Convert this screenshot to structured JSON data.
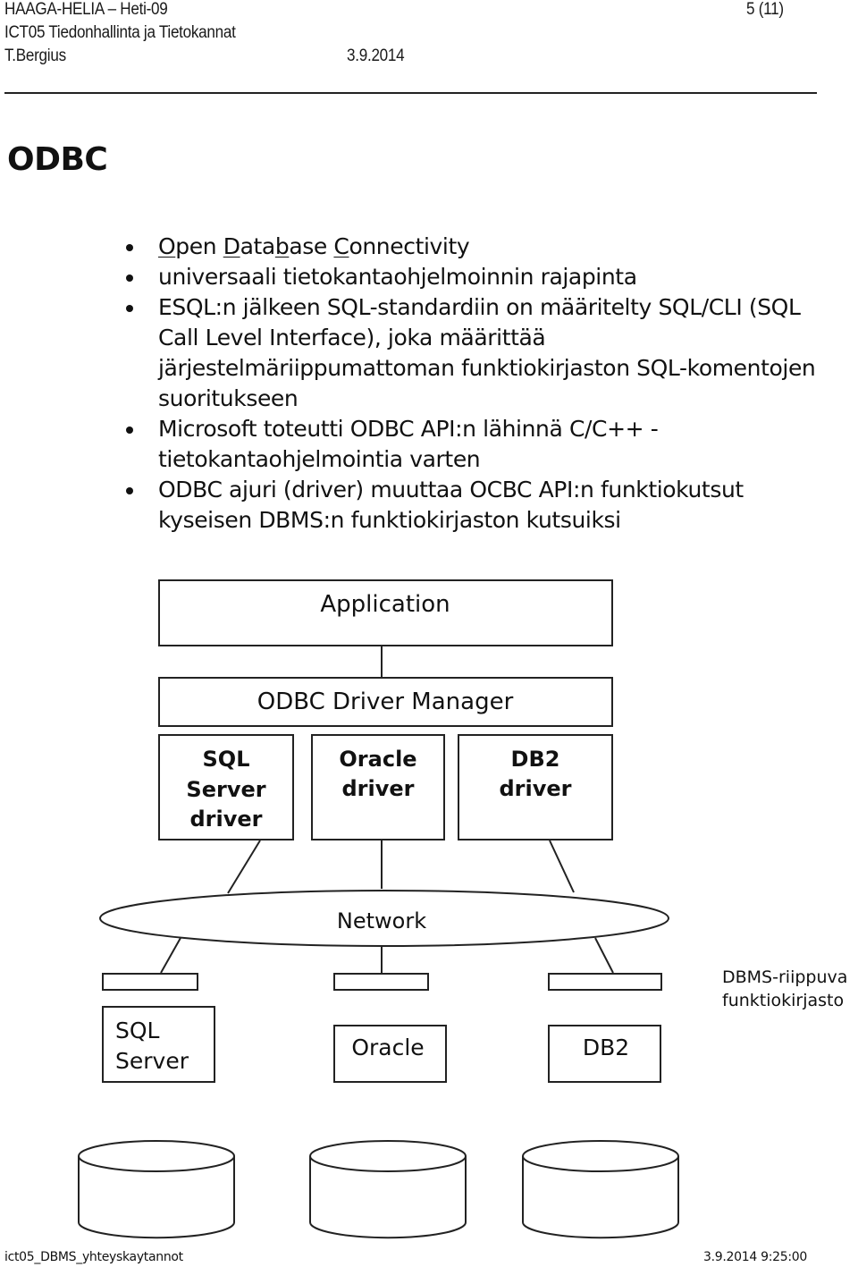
{
  "header": {
    "org": "HAAGA-HELIA",
    "dash": "–",
    "group": "Heti-09",
    "page": "5 (11)",
    "course": "ICT05  Tiedonhallinta ja Tietokannat",
    "author": "T.Bergius",
    "date": "3.9.2014"
  },
  "title": "ODBC",
  "bullets": [
    {
      "parts": [
        {
          "text": "O",
          "u": true
        },
        {
          "text": "pen ",
          "u": false
        },
        {
          "text": "D",
          "u": true
        },
        {
          "text": "ata",
          "u": false
        },
        {
          "text": "b",
          "u": true
        },
        {
          "text": "ase ",
          "u": false
        },
        {
          "text": "C",
          "u": true
        },
        {
          "text": "onnectivity",
          "u": false
        }
      ]
    },
    {
      "text": "universaali tietokantaohjelmoinnin rajapinta"
    },
    {
      "text": "ESQL:n jälkeen SQL-standardiin on määritelty SQL/CLI (SQL Call Level Interface), joka määrittää järjestelmäriippumattoman funktiokirjaston SQL-komentojen suoritukseen"
    },
    {
      "text": "Microsoft toteutti ODBC API:n lähinnä C/C++ -tietokantaohjelmointia varten"
    },
    {
      "text": "ODBC ajuri (driver) muuttaa OCBC API:n funktiokutsut kyseisen DBMS:n funktiokirjaston kutsuiksi"
    }
  ],
  "diagram": {
    "application": "Application",
    "driver_manager": "ODBC Driver Manager",
    "drivers": [
      {
        "lines": [
          "SQL",
          "Server",
          "driver"
        ]
      },
      {
        "lines": [
          "Oracle",
          "driver"
        ]
      },
      {
        "lines": [
          "DB2",
          "driver"
        ]
      }
    ],
    "network": "Network",
    "dbms_library_label": [
      "DBMS-riippuva",
      "funktiokirjasto"
    ],
    "databases": [
      {
        "lines": [
          "SQL",
          "Server"
        ]
      },
      {
        "lines": [
          "Oracle"
        ]
      },
      {
        "lines": [
          "DB2"
        ]
      }
    ]
  },
  "footer": {
    "filename": "ict05_DBMS_yhteyskaytannot",
    "timestamp": "3.9.2014 9:25:00"
  }
}
